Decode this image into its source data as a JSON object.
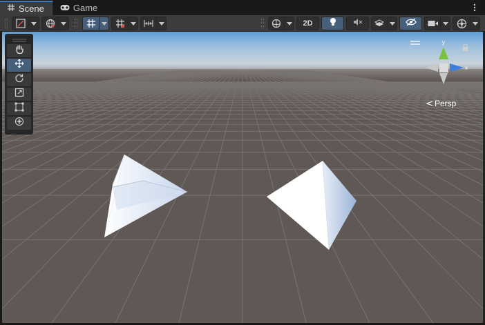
{
  "tabs": [
    {
      "label": "Scene",
      "icon": "grid-icon",
      "active": true
    },
    {
      "label": "Game",
      "icon": "gamepad-icon",
      "active": false
    }
  ],
  "toolbar": {
    "view_2d_label": "2D",
    "accent": "#46607c"
  },
  "viewport": {
    "projection_label": "Persp",
    "axis_labels": {
      "y": "y",
      "x": "x"
    },
    "sky_color": "#a6bed6",
    "ground_color": "#5f5854"
  },
  "tools": [
    {
      "name": "hand-tool",
      "icon": "hand-icon",
      "selected": false
    },
    {
      "name": "move-tool",
      "icon": "move-icon",
      "selected": true
    },
    {
      "name": "rotate-tool",
      "icon": "rotate-icon",
      "selected": false
    },
    {
      "name": "scale-tool",
      "icon": "scale-icon",
      "selected": false
    },
    {
      "name": "rect-tool",
      "icon": "rect-icon",
      "selected": false
    },
    {
      "name": "transform-tool",
      "icon": "transform-icon",
      "selected": false
    }
  ]
}
